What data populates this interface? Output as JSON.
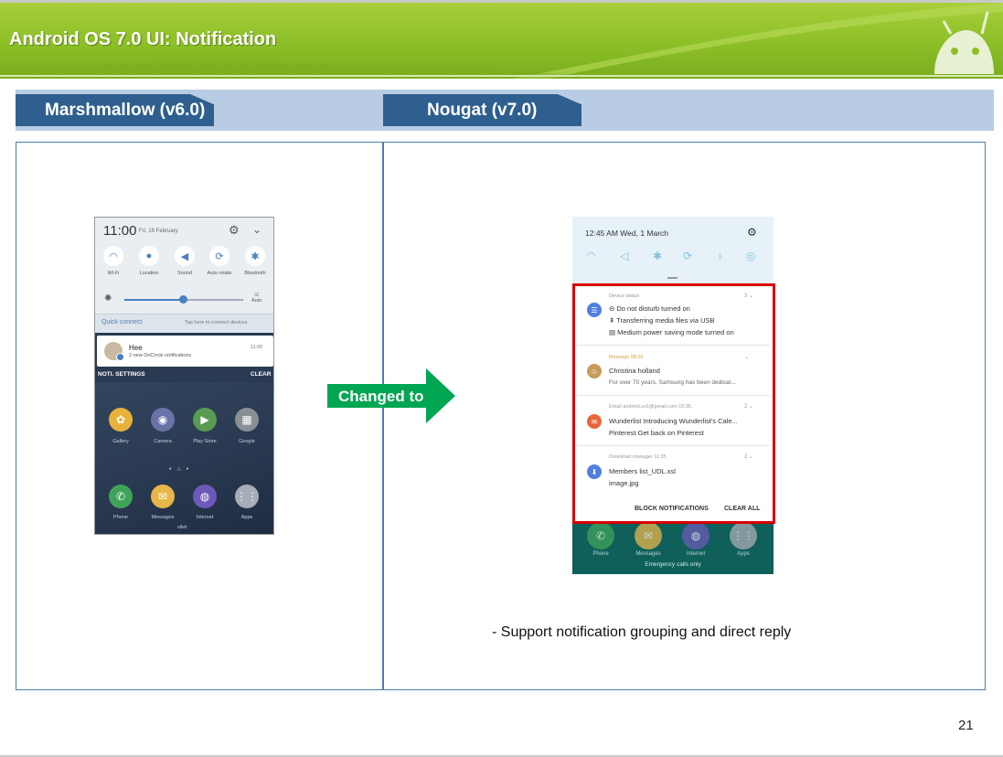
{
  "slide": {
    "title": "Android OS 7.0 UI: Notification",
    "page_number": "21",
    "caption": "- Support notification grouping and direct reply",
    "arrow_label": "Changed to"
  },
  "tabs": {
    "left": "Marshmallow (v6.0)",
    "right": "Nougat (v7.0)"
  },
  "marshmallow": {
    "time": "11:00",
    "date": "Fri, 19 February",
    "quick_settings": [
      {
        "label": "Wi-Fi",
        "icon": "wifi-icon",
        "glyph": "◠"
      },
      {
        "label": "Location",
        "icon": "location-icon",
        "glyph": "●"
      },
      {
        "label": "Sound",
        "icon": "sound-icon",
        "glyph": "◀"
      },
      {
        "label": "Auto rotate",
        "icon": "rotate-icon",
        "glyph": "⟳"
      },
      {
        "label": "Bluetooth",
        "icon": "bluetooth-icon",
        "glyph": "✱"
      }
    ],
    "auto_label": "Auto",
    "quick_connect": "Quick connect",
    "quick_connect_hint": "Tap here to connect devices",
    "notification": {
      "title": "Hee",
      "subtitle": "2 new OnCircle notifications",
      "time": "11:00"
    },
    "noti_settings": "NOTI. SETTINGS",
    "clear": "CLEAR",
    "apps_row1": [
      {
        "label": "Gallery",
        "color": "#e8b23a",
        "glyph": "✿"
      },
      {
        "label": "Camera",
        "color": "#6a73a8",
        "glyph": "◉"
      },
      {
        "label": "Play Store",
        "color": "#5a9b52",
        "glyph": "▶"
      },
      {
        "label": "Google",
        "color": "#8a8f96",
        "glyph": "▦"
      }
    ],
    "apps_row2": [
      {
        "label": "Phone",
        "color": "#3fa45a",
        "glyph": "✆"
      },
      {
        "label": "Messages",
        "color": "#e7b64a",
        "glyph": "✉"
      },
      {
        "label": "Internet",
        "color": "#6d5ab8",
        "glyph": "◍"
      },
      {
        "label": "Apps",
        "color": "#a7adb6",
        "glyph": "⋮⋮"
      }
    ],
    "carrier": "olleh"
  },
  "nougat": {
    "time": "12:45 AM Wed, 1 March",
    "quick_icons": [
      "wifi-icon",
      "mute-icon",
      "bluetooth-icon",
      "rotate-icon",
      "flashlight-icon",
      "location-icon"
    ],
    "cards": [
      {
        "meta": "Device status",
        "count": "3",
        "icon_color": "#4f7fe0",
        "icon_glyph": "☰",
        "lines": [
          "⊖ Do not disturb turned on",
          "⇞ Transferring media files via USB",
          "▤ Medium power saving mode turned on"
        ]
      },
      {
        "meta": "Message 08:02",
        "count": "",
        "icon_color": "#c89b5a",
        "icon_glyph": "☺",
        "lines": [
          "Christina holland"
        ],
        "sub": "For over 70 years, Samsung has been dedicat..."
      },
      {
        "meta": "Email android.ux1@gmail.com 10:35",
        "count": "2",
        "icon_color": "#e8663a",
        "icon_glyph": "✉",
        "lines": [
          "Wunderlist  Introducing Wunderlist's Cale...",
          "Pinterest  Get back on Pinterest"
        ]
      },
      {
        "meta": "Download manager 11:35",
        "count": "2",
        "icon_color": "#4f7fe0",
        "icon_glyph": "⬇",
        "lines": [
          "Members list_UDL.xsl",
          "image.jpg"
        ]
      }
    ],
    "block_notifications": "BLOCK NOTIFICATIONS",
    "clear_all": "CLEAR ALL",
    "dock": [
      {
        "label": "Phone",
        "color": "#3fa45a",
        "glyph": "✆"
      },
      {
        "label": "Messages",
        "color": "#e7b64a",
        "glyph": "✉"
      },
      {
        "label": "Internet",
        "color": "#6d5ab8",
        "glyph": "◍"
      },
      {
        "label": "Apps",
        "color": "#a7adb6",
        "glyph": "⋮⋮"
      }
    ],
    "emergency": "Emergency calls only"
  }
}
